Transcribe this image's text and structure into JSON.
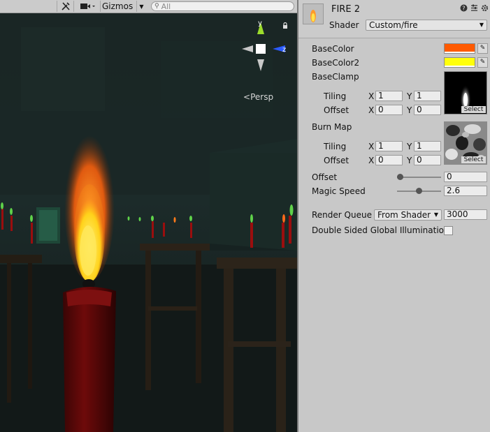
{
  "toolbar": {
    "gizmos_label": "Gizmos",
    "search_placeholder": "All"
  },
  "scene": {
    "persp_label": "Persp",
    "axis_y": "y",
    "axis_z": "z"
  },
  "inspector": {
    "title": "FIRE 2",
    "shader_label": "Shader",
    "shader_value": "Custom/fire",
    "props": {
      "base_color_label": "BaseColor",
      "base_color": "#ff5a00",
      "base_color2_label": "BaseColor2",
      "base_color2": "#ffff0a",
      "base_clamp_label": "BaseClamp",
      "burn_map_label": "Burn Map",
      "tiling_label": "Tiling",
      "offset_label": "Offset",
      "x_label": "X",
      "y_label": "Y",
      "select_label": "Select",
      "base_clamp": {
        "tiling_x": "1",
        "tiling_y": "1",
        "offset_x": "0",
        "offset_y": "0"
      },
      "burn_map": {
        "tiling_x": "1",
        "tiling_y": "1",
        "offset_x": "0",
        "offset_y": "0"
      },
      "offset_slider_label": "Offset",
      "offset_slider_value": "0",
      "offset_slider_fraction": 0.0,
      "magic_speed_label": "Magic Speed",
      "magic_speed_value": "2.6",
      "magic_speed_fraction": 0.5
    },
    "render_queue_label": "Render Queue",
    "render_queue_mode": "From Shader",
    "render_queue_value": "3000",
    "double_sided_gi_label": "Double Sided Global Illumination"
  }
}
